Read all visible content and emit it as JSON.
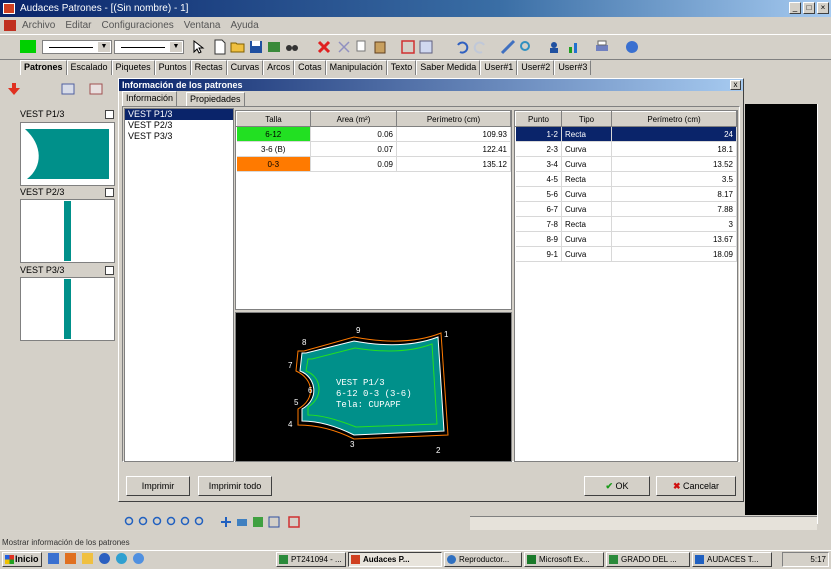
{
  "window": {
    "title": "Audaces Patrones - [(Sin nombre) - 1]"
  },
  "menu": [
    "Archivo",
    "Editar",
    "Configuraciones",
    "Ventana",
    "Ayuda"
  ],
  "main_tabs": [
    "Patrones",
    "Escalado",
    "Piquetes",
    "Puntos",
    "Rectas",
    "Curvas",
    "Arcos",
    "Cotas",
    "Manipulación",
    "Texto",
    "Saber Medida",
    "User#1",
    "User#2",
    "User#3"
  ],
  "left_pieces": [
    "VEST P1/3",
    "VEST P2/3",
    "VEST P3/3"
  ],
  "dialog": {
    "title": "Información de los patrones",
    "close": "x",
    "tabs": [
      "Información",
      "Propiedades"
    ],
    "pieces": [
      "VEST P1/3",
      "VEST P2/3",
      "VEST P3/3"
    ],
    "sizes_table": {
      "headers": [
        "Talla",
        "Area (m²)",
        "Perímetro (cm)"
      ],
      "rows": [
        {
          "size": "6-12",
          "area": "0.06",
          "perimeter": "109.93",
          "color": "#22e022"
        },
        {
          "size": "3-6 (B)",
          "area": "0.07",
          "perimeter": "122.41",
          "color": "#ffffff"
        },
        {
          "size": "0-3",
          "area": "0.09",
          "perimeter": "135.12",
          "color": "#ff7a00"
        }
      ]
    },
    "points_table": {
      "headers": [
        "Punto",
        "Tipo",
        "Perímetro (cm)"
      ],
      "rows": [
        {
          "point": "1-2",
          "type": "Recta",
          "perimeter": "24"
        },
        {
          "point": "2-3",
          "type": "Curva",
          "perimeter": "18.1"
        },
        {
          "point": "3-4",
          "type": "Curva",
          "perimeter": "13.52"
        },
        {
          "point": "4-5",
          "type": "Recta",
          "perimeter": "3.5"
        },
        {
          "point": "5-6",
          "type": "Curva",
          "perimeter": "8.17"
        },
        {
          "point": "6-7",
          "type": "Curva",
          "perimeter": "7.88"
        },
        {
          "point": "7-8",
          "type": "Recta",
          "perimeter": "3"
        },
        {
          "point": "8-9",
          "type": "Curva",
          "perimeter": "13.67"
        },
        {
          "point": "9-1",
          "type": "Curva",
          "perimeter": "18.09"
        }
      ]
    },
    "preview": {
      "text_line1": "VEST P1/3",
      "text_line2": "6-12 0-3 (3-6)",
      "text_line3": "Tela: CUPAPF",
      "point_labels": [
        "1",
        "2",
        "3",
        "4",
        "5",
        "6",
        "7",
        "8",
        "9"
      ]
    },
    "buttons": {
      "print": "Imprimir",
      "print_all": "Imprimir todo",
      "ok": "OK",
      "cancel": "Cancelar"
    }
  },
  "statusbar": "Mostrar información de los patrones",
  "taskbar": {
    "start": "Inicio",
    "tasks": [
      "PT241094 - ...",
      "Audaces P...",
      "Reproductor...",
      "Microsoft Ex...",
      "GRADO DEL ...",
      "AUDACES T..."
    ],
    "clock": "5:17"
  }
}
